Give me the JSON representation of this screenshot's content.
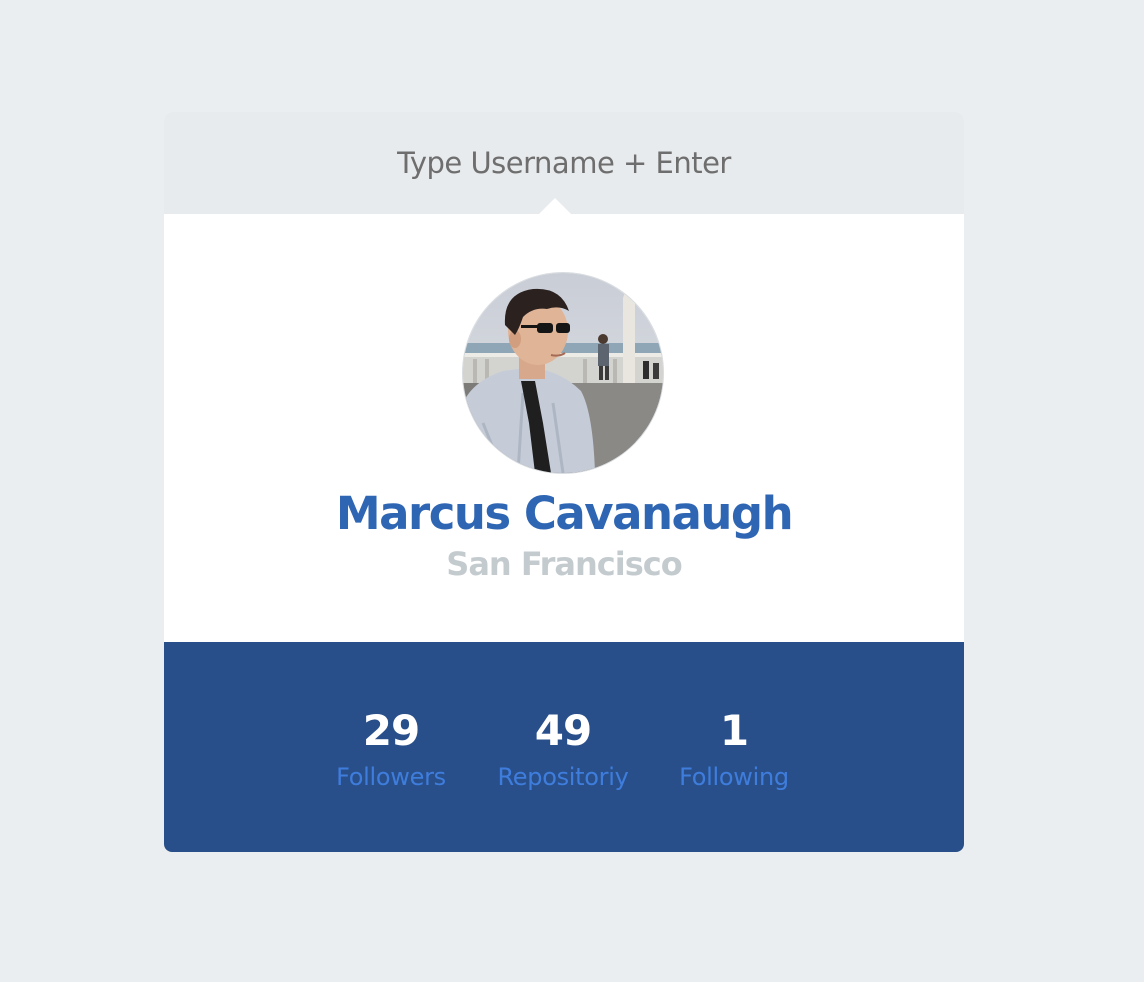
{
  "search": {
    "placeholder": "Type Username + Enter",
    "value": ""
  },
  "profile": {
    "name": "Marcus Cavanaugh",
    "location": "San Francisco",
    "avatar_icon": "user-photo"
  },
  "stats": [
    {
      "value": "29",
      "label": "Followers"
    },
    {
      "value": "49",
      "label": "Repositoriy"
    },
    {
      "value": "1",
      "label": "Following"
    }
  ],
  "colors": {
    "page_background": "#ebeef0",
    "search_background": "#e8ebed",
    "name": "#2f66b3",
    "location": "#c4cbcf",
    "stats_background": "#284f8a",
    "stat_value": "#ffffff",
    "stat_label": "#3f7ddd"
  }
}
